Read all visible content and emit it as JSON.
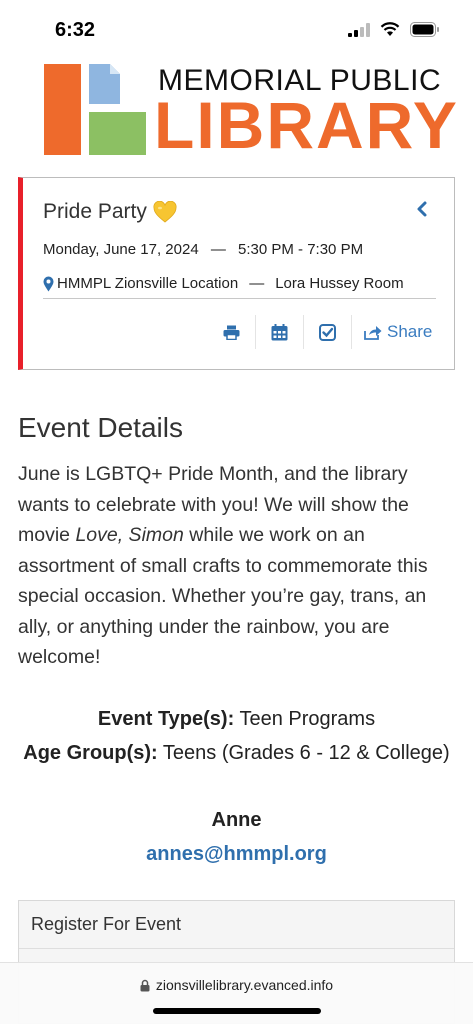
{
  "status_bar": {
    "time": "6:32",
    "icons": [
      "cellular-signal-icon",
      "wifi-icon",
      "battery-icon"
    ]
  },
  "header": {
    "logo_top": "MEMORIAL PUBLIC",
    "logo_bottom": "LIBRARY",
    "brand_colors": {
      "orange": "#ee6a2c",
      "blue": "#8fb6e0",
      "green": "#8cc063"
    }
  },
  "event": {
    "title": "Pride Party",
    "title_icon": "yellow-heart-icon",
    "date": "Monday, June 17, 2024",
    "separator": "—",
    "time": "5:30 PM - 7:30 PM",
    "location": "HMMPL Zionsville Location",
    "room": "Lora Hussey Room",
    "accent_color": "#e8202a",
    "actions": {
      "print_icon": "print-icon",
      "calendar_icon": "calendar-icon",
      "checkin_icon": "check-square-icon",
      "share_label": "Share",
      "share_icon": "share-icon"
    }
  },
  "details": {
    "heading": "Event Details",
    "body_before": "June is LGBTQ+ Pride Month, and the library wants to celebrate with you! We will show the movie ",
    "movie": "Love, Simon",
    "body_after": " while we work on an assortment of small crafts to commemorate this special occasion. Whether you’re gay, trans, an ally, or anything under the rainbow, you are welcome!",
    "event_type_label": "Event Type(s):",
    "event_type_value": "Teen Programs",
    "age_group_label": "Age Group(s):",
    "age_group_value": "Teens (Grades 6 - 12 & College)",
    "contact_name": "Anne",
    "contact_email": "annes@hmmpl.org"
  },
  "register": {
    "title": "Register For Event"
  },
  "browser": {
    "url": "zionsvillelibrary.evanced.info",
    "lock_icon": "lock-icon"
  }
}
